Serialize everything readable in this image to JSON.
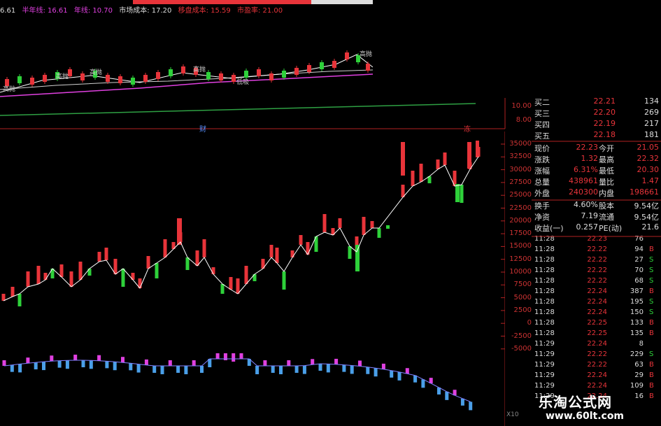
{
  "top_info": {
    "first_value": "6.61",
    "half_year_line": "半年线: 16.61",
    "year_line": "年线: 10.70",
    "market_cost": "市场成本: 17.20",
    "locked_cost": "移盘成本: 15.59",
    "pe_ratio": "市盈率: 21.00"
  },
  "top_chart_labels": [
    "高抛",
    "高抛",
    "高抛",
    "高抛",
    "低吸",
    "高抛"
  ],
  "mid_axis": {
    "ticks": [
      "10.00",
      "8.00"
    ],
    "markers": [
      "财",
      "冻"
    ]
  },
  "right_axis": {
    "ticks": [
      "35000",
      "32500",
      "30000",
      "27500",
      "25000",
      "22500",
      "20000",
      "17500",
      "15000",
      "12500",
      "10000",
      "7500",
      "5000",
      "2500",
      "0",
      "-2500",
      "-5000"
    ],
    "scale_label": "X10"
  },
  "colors": {
    "up": "#e8343a",
    "down": "#2ed13a",
    "blue": "#4a9fe8",
    "magenta": "#e040e0",
    "axis": "#b22222"
  },
  "quote": {
    "depth": [
      {
        "label": "买二",
        "price": "22.21",
        "vol": "134"
      },
      {
        "label": "买三",
        "price": "22.20",
        "vol": "269"
      },
      {
        "label": "买四",
        "price": "22.19",
        "vol": "217"
      },
      {
        "label": "买五",
        "price": "22.18",
        "vol": "181"
      }
    ],
    "stats": [
      {
        "l1": "现价",
        "v1": "22.23",
        "l2": "今开",
        "v2": "21.05"
      },
      {
        "l1": "涨跌",
        "v1": "1.32",
        "l2": "最高",
        "v2": "22.32"
      },
      {
        "l1": "涨幅",
        "v1": "6.31%",
        "l2": "最低",
        "v2": "20.30"
      },
      {
        "l1": "总量",
        "v1": "438961",
        "l2": "量比",
        "v2": "1.47"
      },
      {
        "l1": "外盘",
        "v1": "240300",
        "l2": "内盘",
        "v2": "198661"
      }
    ],
    "fundamentals": [
      {
        "l1": "换手",
        "v1": "4.60%",
        "l2": "股本",
        "v2": "9.54亿"
      },
      {
        "l1": "净资",
        "v1": "7.19",
        "l2": "流通",
        "v2": "9.54亿"
      },
      {
        "l1": "收益(一)",
        "v1": "0.257",
        "l2": "PE(动)",
        "v2": "21.6"
      }
    ],
    "trades": [
      {
        "time": "11:28",
        "price": "22.23",
        "vol": "76",
        "side": ""
      },
      {
        "time": "11:28",
        "price": "22.22",
        "vol": "94",
        "side": "B"
      },
      {
        "time": "11:28",
        "price": "22.22",
        "vol": "27",
        "side": "S"
      },
      {
        "time": "11:28",
        "price": "22.22",
        "vol": "70",
        "side": "S"
      },
      {
        "time": "11:28",
        "price": "22.22",
        "vol": "68",
        "side": "S"
      },
      {
        "time": "11:28",
        "price": "22.24",
        "vol": "387",
        "side": "B"
      },
      {
        "time": "11:28",
        "price": "22.24",
        "vol": "195",
        "side": "S"
      },
      {
        "time": "11:28",
        "price": "22.24",
        "vol": "150",
        "side": "S"
      },
      {
        "time": "11:28",
        "price": "22.25",
        "vol": "133",
        "side": "B"
      },
      {
        "time": "11:28",
        "price": "22.25",
        "vol": "135",
        "side": "B"
      },
      {
        "time": "11:29",
        "price": "22.24",
        "vol": "8",
        "side": ""
      },
      {
        "time": "11:29",
        "price": "22.22",
        "vol": "229",
        "side": "S"
      },
      {
        "time": "11:29",
        "price": "22.22",
        "vol": "63",
        "side": "B"
      },
      {
        "time": "11:29",
        "price": "22.24",
        "vol": "29",
        "side": "B"
      },
      {
        "time": "11:29",
        "price": "22.24",
        "vol": "109",
        "side": "B"
      },
      {
        "time": "11:29",
        "price": "22.24",
        "vol": "16",
        "side": "B"
      }
    ]
  },
  "watermark": {
    "title": "乐淘公式网",
    "url": "www.60lt.com"
  }
}
